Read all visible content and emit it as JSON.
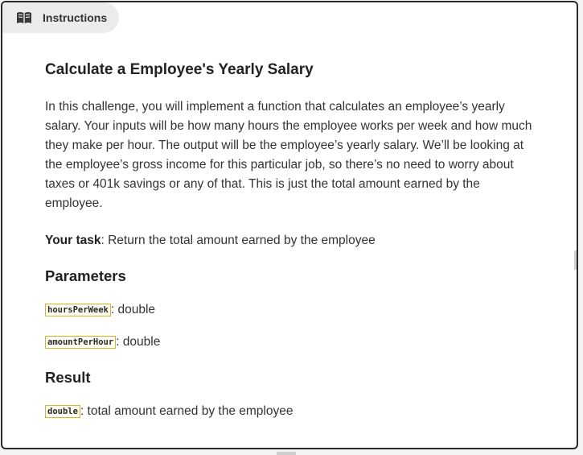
{
  "tab": {
    "label": "Instructions",
    "icon": "book-icon"
  },
  "title": "Calculate a Employee's Yearly Salary",
  "description": "In this challenge, you will implement a function that calculates an employee’s yearly salary. Your inputs will be how many hours the employee works per week and how much they make per hour. The output will be the employee’s yearly salary. We’ll be looking at the employee’s gross income for this particular job, so there’s no need to worry about taxes or 401k savings or any of that. This is just the total amount earned by the employee.",
  "task": {
    "label": "Your task",
    "text": ": Return the total amount earned by the employee"
  },
  "parameters": {
    "heading": "Parameters",
    "items": [
      {
        "name": "hoursPerWeek",
        "type": ": double"
      },
      {
        "name": "amountPerHour",
        "type": ": double"
      }
    ]
  },
  "result": {
    "heading": "Result",
    "name": "double",
    "text": ": total amount earned by the employee"
  },
  "colors": {
    "code_border": "#d4b531",
    "panel_border": "#2a2a2a",
    "tab_bg": "#ececec"
  }
}
